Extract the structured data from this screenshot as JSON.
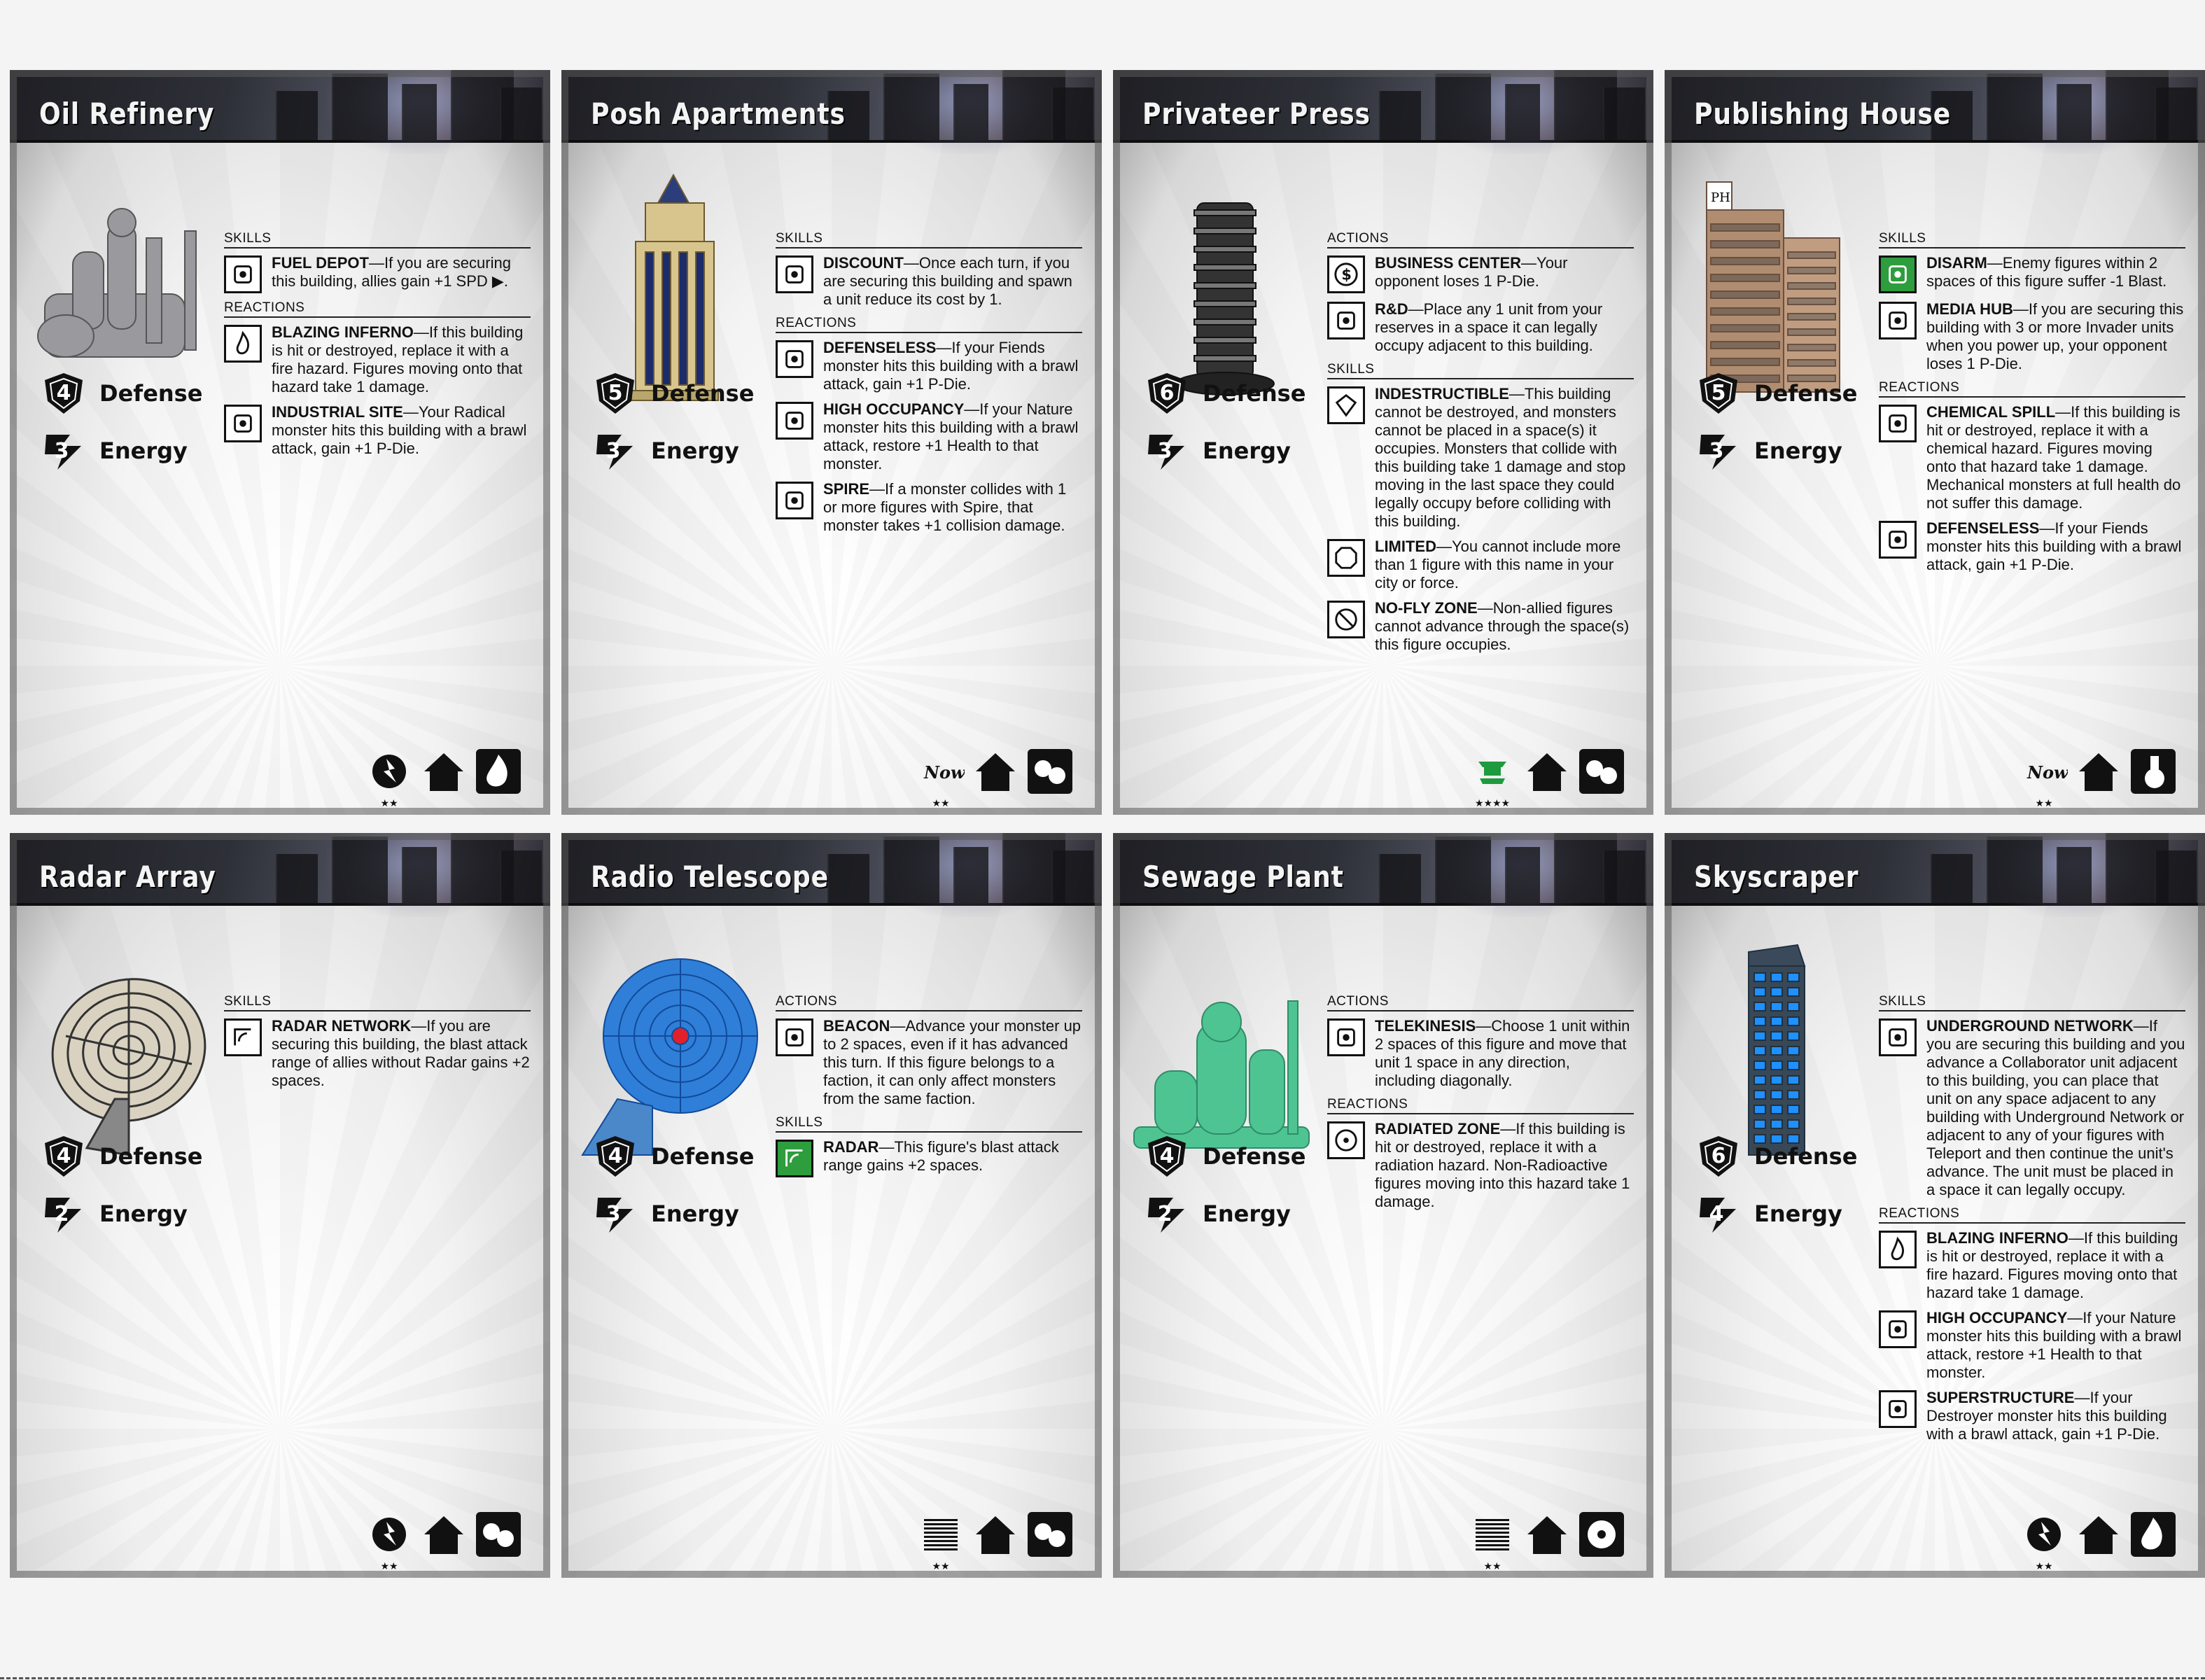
{
  "cards": [
    {
      "title": "Oil Refinery",
      "figure": "oil-refinery",
      "defense": "4",
      "defense_label": "Defense",
      "energy": "3",
      "energy_label": "Energy",
      "sections": [
        {
          "label": "SKILLS",
          "abilities": [
            {
              "icon": "fuel-icon",
              "name": "FUEL DEPOT",
              "text": "—If you are securing this building, allies gain +1 SPD ▶."
            }
          ]
        },
        {
          "label": "REACTIONS",
          "abilities": [
            {
              "icon": "fire-icon",
              "name": "BLAZING INFERNO",
              "text": "—If this building is hit or destroyed, replace it with a fire hazard. Figures moving onto that hazard take 1 damage."
            },
            {
              "icon": "radical-icon",
              "name": "INDUSTRIAL SITE",
              "text": "—Your Radical monster hits this building with a brawl attack, gain +1 P-Die."
            }
          ]
        }
      ],
      "footer": {
        "rarity": "★★",
        "faction": "radical-faction-icon",
        "type": "building-icon",
        "role": "fire-role-icon"
      }
    },
    {
      "title": "Posh Apartments",
      "figure": "posh-apartments",
      "defense": "5",
      "defense_label": "Defense",
      "energy": "3",
      "energy_label": "Energy",
      "sections": [
        {
          "label": "SKILLS",
          "abilities": [
            {
              "icon": "discount-icon",
              "name": "DISCOUNT",
              "text": "—Once each turn, if you are securing this building and spawn a unit reduce its cost by 1."
            }
          ]
        },
        {
          "label": "REACTIONS",
          "abilities": [
            {
              "icon": "defenseless-icon",
              "name": "DEFENSELESS",
              "text": "—If your Fiends monster hits this building with a brawl attack, gain +1 P-Die."
            },
            {
              "icon": "occupancy-icon",
              "name": "HIGH OCCUPANCY",
              "text": "—If your Nature monster hits this building with a brawl attack, restore +1 Health to that monster."
            },
            {
              "icon": "spire-icon",
              "name": "SPIRE",
              "text": "—If a monster collides with 1 or more figures with Spire, that monster takes +1 collision damage."
            }
          ]
        }
      ],
      "footer": {
        "rarity": "★★",
        "faction": "now-faction-icon",
        "type": "building-icon",
        "role": "rubble-role-icon"
      }
    },
    {
      "title": "Privateer Press",
      "figure": "privateer-press",
      "defense": "6",
      "defense_label": "Defense",
      "energy": "3",
      "energy_label": "Energy",
      "sections": [
        {
          "label": "ACTIONS",
          "abilities": [
            {
              "icon": "dollar-icon",
              "name": "BUSINESS CENTER",
              "text": "—Your opponent loses 1 P-Die."
            },
            {
              "icon": "research-icon",
              "name": "R&D",
              "text": "—Place any 1 unit from your reserves in a space it can legally occupy adjacent to this building."
            }
          ]
        },
        {
          "label": "SKILLS",
          "abilities": [
            {
              "icon": "diamond-icon",
              "name": "INDESTRUCTIBLE",
              "text": "—This building cannot be destroyed, and monsters cannot be placed in a space(s) it occupies. Monsters that collide with this building take 1 damage and stop moving in the last space they could legally occupy before colliding with this building."
            },
            {
              "icon": "limited-icon",
              "name": "LIMITED",
              "text": "—You cannot include more than 1 figure with this name in your city or force."
            },
            {
              "icon": "no-fly-icon",
              "name": "NO-FLY ZONE",
              "text": "—Non-allied figures cannot advance through the space(s) this figure occupies."
            }
          ]
        }
      ],
      "footer": {
        "rarity": "★★★★",
        "faction": "pagoda-faction-icon",
        "type": "building-icon",
        "role": "rubble-role-icon"
      }
    },
    {
      "title": "Publishing House",
      "figure": "publishing-house",
      "defense": "5",
      "defense_label": "Defense",
      "energy": "3",
      "energy_label": "Energy",
      "sections": [
        {
          "label": "SKILLS",
          "abilities": [
            {
              "icon": "disarm-icon",
              "name": "DISARM",
              "text": "—Enemy figures within 2 spaces of this figure suffer -1 Blast.",
              "green": true
            },
            {
              "icon": "media-icon",
              "name": "MEDIA HUB",
              "text": "—If you are securing this building with 3 or more Invader units when you power up, your opponent loses 1 P-Die."
            }
          ]
        },
        {
          "label": "REACTIONS",
          "abilities": [
            {
              "icon": "chemical-icon",
              "name": "CHEMICAL SPILL",
              "text": "—If this building is hit or destroyed, replace it with a chemical hazard. Figures moving onto that hazard take 1 damage. Mechanical monsters at full health do not suffer this damage."
            },
            {
              "icon": "defenseless-icon",
              "name": "DEFENSELESS",
              "text": "—If your Fiends monster hits this building with a brawl attack, gain +1 P-Die."
            }
          ]
        }
      ],
      "footer": {
        "rarity": "★★",
        "faction": "now-faction-icon",
        "type": "building-icon",
        "role": "chemical-role-icon"
      }
    },
    {
      "title": "Radar Array",
      "figure": "radar-array",
      "defense": "4",
      "defense_label": "Defense",
      "energy": "2",
      "energy_label": "Energy",
      "sections": [
        {
          "label": "SKILLS",
          "abilities": [
            {
              "icon": "radar-icon",
              "name": "RADAR NETWORK",
              "text": "—If you are securing this building, the blast attack range of allies without Radar gains +2 spaces."
            }
          ]
        }
      ],
      "footer": {
        "rarity": "★★",
        "faction": "radical-faction-icon",
        "type": "building-icon",
        "role": "rubble-role-icon"
      }
    },
    {
      "title": "Radio Telescope",
      "figure": "radio-telescope",
      "defense": "4",
      "defense_label": "Defense",
      "energy": "3",
      "energy_label": "Energy",
      "sections": [
        {
          "label": "ACTIONS",
          "abilities": [
            {
              "icon": "beacon-icon",
              "name": "BEACON",
              "text": "—Advance your monster up to 2 spaces, even if it has advanced this turn. If this figure belongs to a faction, it can only affect monsters from the same faction."
            }
          ]
        },
        {
          "label": "SKILLS",
          "abilities": [
            {
              "icon": "radar-icon",
              "name": "RADAR",
              "text": "—This figure's blast attack range gains +2 spaces.",
              "green": true
            }
          ]
        }
      ],
      "footer": {
        "rarity": "★★",
        "faction": "sunburst-faction-icon",
        "type": "building-icon",
        "role": "rubble-role-icon"
      }
    },
    {
      "title": "Sewage Plant",
      "figure": "sewage-plant",
      "defense": "4",
      "defense_label": "Defense",
      "energy": "2",
      "energy_label": "Energy",
      "sections": [
        {
          "label": "ACTIONS",
          "abilities": [
            {
              "icon": "telekinesis-icon",
              "name": "TELEKINESIS",
              "text": "—Choose 1 unit within 2 spaces of this figure and move that unit 1 space in any direction, including diagonally."
            }
          ]
        },
        {
          "label": "REACTIONS",
          "abilities": [
            {
              "icon": "radiation-icon",
              "name": "RADIATED ZONE",
              "text": "—If this building is hit or destroyed, replace it with a radiation hazard. Non-Radioactive figures moving into this hazard take 1 damage."
            }
          ]
        }
      ],
      "footer": {
        "rarity": "★★",
        "faction": "sunburst-faction-icon",
        "type": "building-icon",
        "role": "radiation-role-icon"
      }
    },
    {
      "title": "Skyscraper",
      "figure": "skyscraper",
      "defense": "6",
      "defense_label": "Defense",
      "energy": "4",
      "energy_label": "Energy",
      "sections": [
        {
          "label": "SKILLS",
          "abilities": [
            {
              "icon": "underground-icon",
              "name": "UNDERGROUND NETWORK",
              "text": "—If you are securing this building and you advance a Collaborator unit adjacent to this building, you can place that unit on any space adjacent to any building with Underground Network or adjacent to any of your figures with Teleport and then continue the unit's advance. The unit must be placed in a space it can legally occupy."
            }
          ]
        },
        {
          "label": "REACTIONS",
          "abilities": [
            {
              "icon": "fire-icon",
              "name": "BLAZING INFERNO",
              "text": "—If this building is hit or destroyed, replace it with a fire hazard. Figures moving onto that hazard take 1 damage."
            },
            {
              "icon": "occupancy-icon",
              "name": "HIGH OCCUPANCY",
              "text": "—If your Nature monster hits this building with a brawl attack, restore +1 Health to that monster."
            },
            {
              "icon": "superstructure-icon",
              "name": "SUPERSTRUCTURE",
              "text": "—If your Destroyer monster hits this building with a brawl attack, gain +1 P-Die."
            }
          ]
        }
      ],
      "footer": {
        "rarity": "★★",
        "faction": "radical-faction-icon",
        "type": "building-icon",
        "role": "fire-role-icon"
      }
    }
  ]
}
